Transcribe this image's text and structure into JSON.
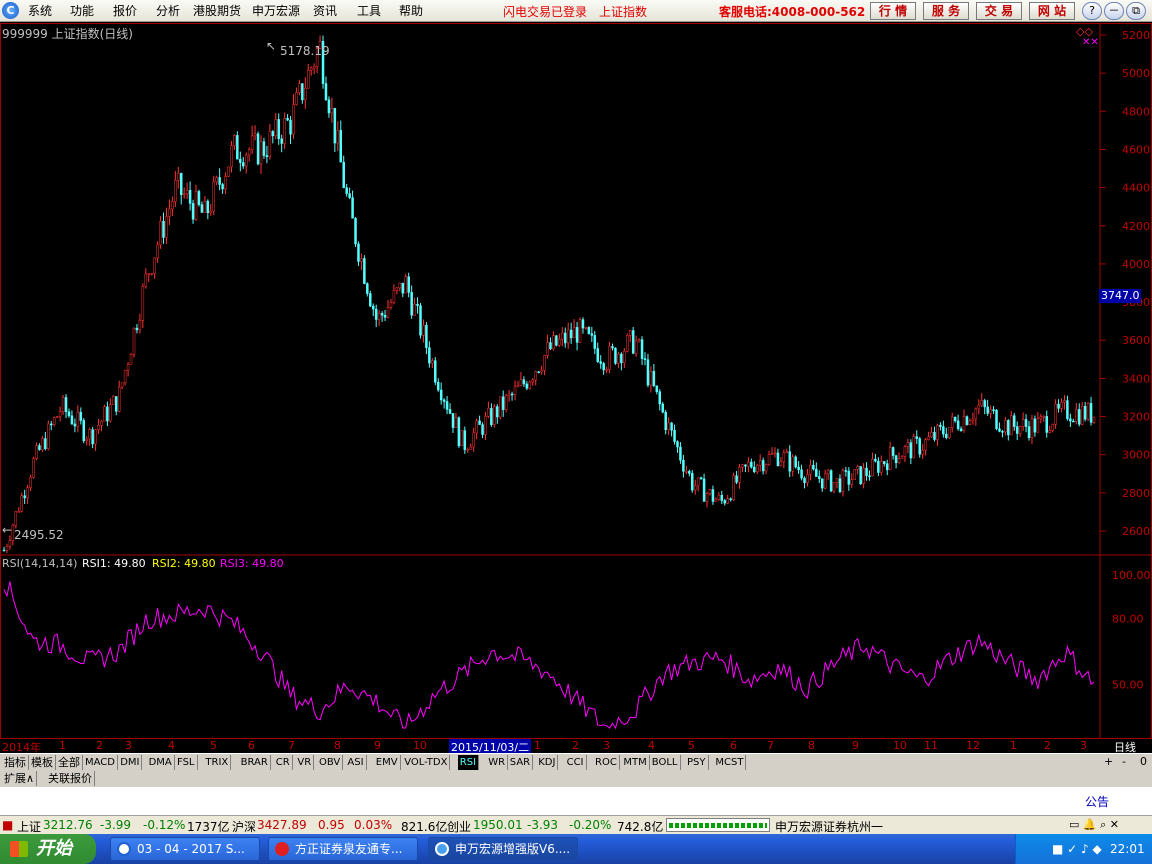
{
  "menu": [
    "系统",
    "功能",
    "报价",
    "分析",
    "港股期货",
    "申万宏源",
    "资讯",
    "工具",
    "帮助"
  ],
  "status_login": "闪电交易已登录",
  "status_index": "上证指数",
  "hotline": "客服电话:4008-000-562",
  "top_buttons": [
    "行 情",
    "服 务",
    "交 易",
    "网 站"
  ],
  "window_buttons": [
    "?",
    "－",
    "⧉",
    "✕"
  ],
  "chart": {
    "title": "999999 上证指数(日线)",
    "high_label": "5178.19",
    "low_label": "2495.52",
    "current_price": "3747.0",
    "y_ticks": [
      "5200",
      "5000",
      "4800",
      "4600",
      "4400",
      "4200",
      "4000",
      "3800",
      "3600",
      "3400",
      "3200",
      "3000",
      "2800",
      "2600"
    ],
    "rsi_label": "RSI(14,14,14)",
    "rsi1": "RSI1: 49.80",
    "rsi2": "RSI2: 49.80",
    "rsi3": "RSI3: 49.80",
    "rsi_ticks": [
      "100.00",
      "80.00",
      "50.00"
    ],
    "colors": {
      "up": "#ff3232",
      "down": "#54ffff",
      "rsi": "#ff00ff",
      "rsi2": "#ffff00"
    }
  },
  "chart_data": {
    "type": "candlestick",
    "x": [
      "2014-01",
      "2014-02",
      "2014-03",
      "2014-04",
      "2014-05",
      "2014-06",
      "2014-07",
      "2014-08",
      "2014-09",
      "2014-10",
      "2014-11",
      "2014-12",
      "2015-01",
      "2015-02",
      "2015-03",
      "2015-04",
      "2015-05",
      "2015-06",
      "2015-07",
      "2015-08",
      "2015-09",
      "2015-10",
      "2015-11",
      "2015-12",
      "2016-01",
      "2016-02",
      "2016-03",
      "2016-04",
      "2016-05",
      "2016-06",
      "2016-07",
      "2016-08",
      "2016-09",
      "2016-10",
      "2016-11",
      "2016-12",
      "2017-01",
      "2017-02",
      "2017-03"
    ],
    "close": [
      2500,
      2950,
      3250,
      3100,
      3300,
      3950,
      4400,
      4250,
      4600,
      4600,
      4750,
      5150,
      4300,
      3700,
      3900,
      3450,
      3050,
      3200,
      3350,
      3550,
      3650,
      3500,
      3600,
      3200,
      2850,
      2750,
      2950,
      3000,
      2900,
      2850,
      2900,
      3000,
      3050,
      3150,
      3250,
      3150,
      3150,
      3230,
      3212
    ],
    "ylim": [
      2495.52,
      5178.19
    ],
    "rsi": [
      98,
      70,
      68,
      60,
      65,
      80,
      82,
      85,
      78,
      65,
      45,
      38,
      50,
      42,
      30,
      45,
      55,
      65,
      62,
      55,
      42,
      30,
      38,
      55,
      60,
      62,
      52,
      58,
      48,
      60,
      68,
      58,
      52,
      62,
      70,
      60,
      52,
      65,
      50
    ]
  },
  "dates": [
    "2014年",
    "1",
    "2",
    "3",
    "4",
    "5",
    "6",
    "7",
    "8",
    "9",
    "10",
    "2015/11/03/二",
    "1",
    "2",
    "3",
    "4",
    "5",
    "6",
    "7",
    "8",
    "9",
    "10",
    "11",
    "12",
    "1",
    "2",
    "3"
  ],
  "period": "日线",
  "tabs": [
    "指标",
    "模板",
    "全部",
    "MACD",
    "DMI",
    "DMA",
    "FSL",
    "TRIX",
    "BRAR",
    "CR",
    "VR",
    "OBV",
    "ASI",
    "EMV",
    "VOL-TDX",
    "RSI",
    "WR",
    "SAR",
    "KDJ",
    "CCI",
    "ROC",
    "MTM",
    "BOLL",
    "PSY",
    "MCST"
  ],
  "tab_controls": [
    "+",
    "-",
    "0"
  ],
  "tabs2": [
    "扩展∧",
    "关联报价"
  ],
  "notice": "公告",
  "ticker": {
    "sh_label": "上证",
    "sh_val": "3212.76",
    "sh_chg": "-3.99",
    "sh_pct": "-0.12%",
    "sh_amt": "1737亿",
    "hs_label": "沪深",
    "hs_val": "3427.89",
    "hs_chg": "0.95",
    "hs_pct": "0.03%",
    "hs_amt": "821.6亿",
    "cy_label": "创业",
    "cy_val": "1950.01",
    "cy_chg": "-3.93",
    "cy_pct": "-0.20%",
    "cy_amt": "742.8亿",
    "broker": "申万宏源证券杭州一"
  },
  "taskbar": {
    "start": "开始",
    "tasks": [
      "03 - 04 - 2017 S...",
      "方正证券泉友通专...",
      "申万宏源增强版V6...."
    ],
    "time": "22:01"
  }
}
